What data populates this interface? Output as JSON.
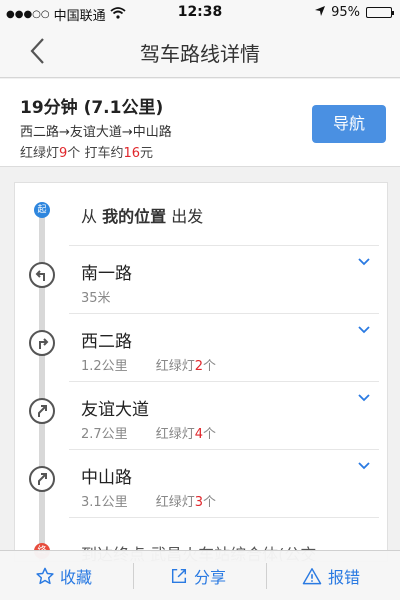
{
  "status": {
    "carrier": "中国联通",
    "time": "12:38",
    "battery": "95%",
    "battery_level": 0.95
  },
  "header": {
    "title": "驾车路线详情"
  },
  "summary": {
    "headline": "19分钟 (7.1公里)",
    "route": "西二路→友谊大道→中山路",
    "lights_label": "红绿灯",
    "lights_count": "9",
    "lights_unit": "个",
    "fare_label": "打车约",
    "fare_amount": "16",
    "fare_unit": "元",
    "nav_button": "导航"
  },
  "route": {
    "start_badge": "起",
    "start_prefix": "从",
    "start_place": "我的位置",
    "start_suffix": "出发",
    "steps": [
      {
        "name": "南一路",
        "distance": "35米",
        "lights_label": "",
        "lights_count": "",
        "lights_unit": ""
      },
      {
        "name": "西二路",
        "distance": "1.2公里",
        "lights_label": "红绿灯",
        "lights_count": "2",
        "lights_unit": "个"
      },
      {
        "name": "友谊大道",
        "distance": "2.7公里",
        "lights_label": "红绿灯",
        "lights_count": "4",
        "lights_unit": "个"
      },
      {
        "name": "中山路",
        "distance": "3.1公里",
        "lights_label": "红绿灯",
        "lights_count": "3",
        "lights_unit": "个"
      }
    ],
    "end_badge": "终",
    "end_text": "到达终点 武昌火车站综合体(公交"
  },
  "toolbar": {
    "favorite": "收藏",
    "share": "分享",
    "report": "报错"
  },
  "colors": {
    "accent": "#2a7ae2",
    "nav_button": "#4a90e2",
    "highlight": "#e0262b"
  }
}
